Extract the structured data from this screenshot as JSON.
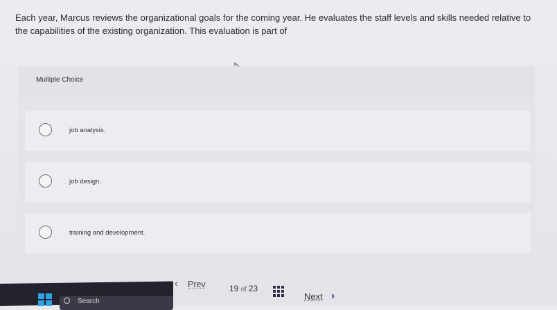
{
  "question": {
    "text": "Each year, Marcus reviews the organizational goals for the coming year. He evaluates the staff levels and skills needed relative to the capabilities of the existing organization. This evaluation is part of"
  },
  "question_type": "Multiple Choice",
  "options": [
    {
      "label": "job analysis.",
      "selected": false
    },
    {
      "label": "job design.",
      "selected": false
    },
    {
      "label": "training and development.",
      "selected": false
    }
  ],
  "navigation": {
    "prev_label": "Prev",
    "prev_icon": "chevron-left-icon",
    "current": "19",
    "of_label": "of",
    "total": "23",
    "grid_icon": "question-grid-icon",
    "next_label": "Next",
    "next_icon": "chevron-right-icon"
  },
  "taskbar": {
    "search_label": "Search",
    "start_icon": "windows-start-icon",
    "search_icon": "search-icon"
  },
  "colors": {
    "accent": "#2d3a8a",
    "taskbar": "#23232d",
    "windows_blue": "#2fa3e6"
  }
}
